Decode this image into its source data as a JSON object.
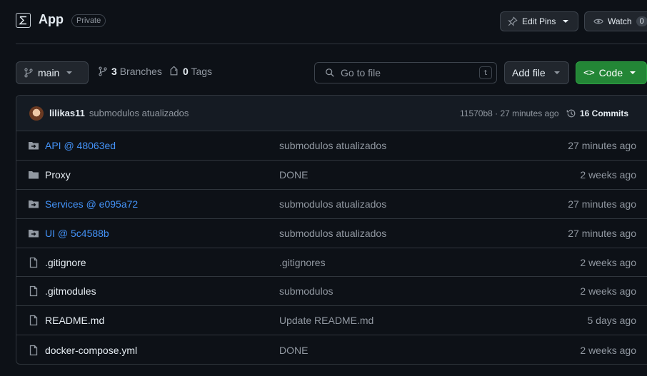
{
  "header": {
    "repo_name": "App",
    "visibility": "Private",
    "edit_pins_label": "Edit Pins",
    "watch_label": "Watch",
    "watch_count": "0"
  },
  "toolbar": {
    "branch_name": "main",
    "branches_count": "3",
    "branches_label": "Branches",
    "tags_count": "0",
    "tags_label": "Tags",
    "search_placeholder": "Go to file",
    "search_shortcut": "t",
    "add_file_label": "Add file",
    "code_label": "Code"
  },
  "latest_commit": {
    "author": "lilikas11",
    "message": "submodulos atualizados",
    "meta": "11570b8 · 27 minutes ago",
    "commits_label": "16 Commits"
  },
  "files": [
    {
      "type": "submodule",
      "name": "API @ 48063ed",
      "message": "submodulos atualizados",
      "date": "27 minutes ago"
    },
    {
      "type": "folder",
      "name": "Proxy",
      "message": "DONE",
      "date": "2 weeks ago"
    },
    {
      "type": "submodule",
      "name": "Services @ e095a72",
      "message": "submodulos atualizados",
      "date": "27 minutes ago"
    },
    {
      "type": "submodule",
      "name": "UI @ 5c4588b",
      "message": "submodulos atualizados",
      "date": "27 minutes ago"
    },
    {
      "type": "file",
      "name": ".gitignore",
      "message": ".gitignores",
      "date": "2 weeks ago"
    },
    {
      "type": "file",
      "name": ".gitmodules",
      "message": "submodulos",
      "date": "2 weeks ago"
    },
    {
      "type": "file",
      "name": "README.md",
      "message": "Update README.md",
      "date": "5 days ago"
    },
    {
      "type": "file",
      "name": "docker-compose.yml",
      "message": "DONE",
      "date": "2 weeks ago"
    }
  ]
}
